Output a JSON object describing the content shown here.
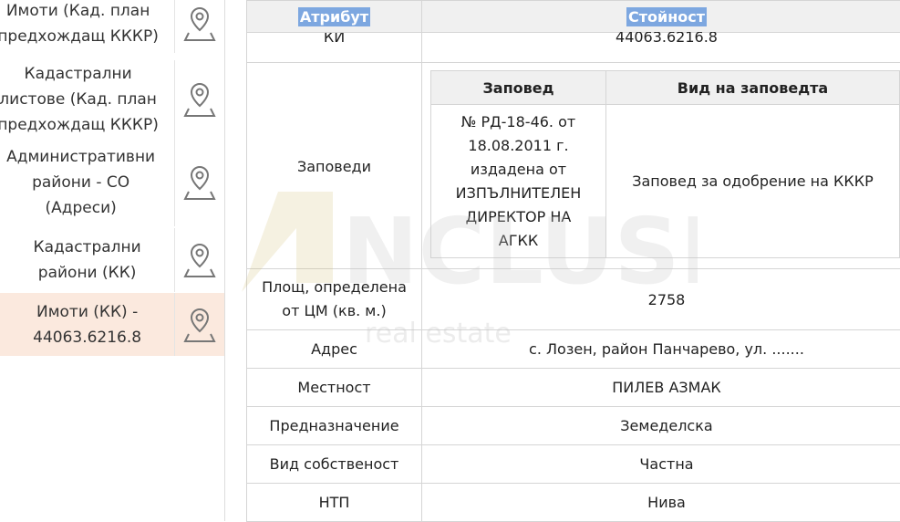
{
  "sidebar": {
    "items": [
      {
        "label": "Имоти (Кад. план\nпредхождащ КККР)",
        "icon": "map-pin-icon"
      },
      {
        "label": "Кадастрални\nлистове (Кад. план\nпредхождащ КККР)",
        "icon": "map-pin-icon"
      },
      {
        "label": "Административни\nрайони - СО\n(Адреси)",
        "icon": "map-pin-icon"
      },
      {
        "label": "Кадастрални\nрайони (КК)",
        "icon": "map-pin-icon"
      },
      {
        "label": "Имоти (КК) -\n44063.6216.8",
        "icon": "map-pin-icon",
        "active": true
      }
    ]
  },
  "table": {
    "col_attr": "Атрибут",
    "col_value": "Стойност",
    "first_row": {
      "attr": "КИ",
      "value": "44063.6216.8"
    },
    "orders": {
      "attr": "Заповеди",
      "col_order": "Заповед",
      "col_type": "Вид на заповедта",
      "order_text": "№ РД-18-46. от\n18.08.2011 г.\nиздадена от\nИЗПЪЛНИТЕЛЕН\nДИРЕКТОР НА\nАГКК",
      "order_type": "Заповед за одобрение на КККР"
    },
    "rows": [
      {
        "attr": "Площ, определена\nот ЦМ (кв. м.)",
        "value": "2758"
      },
      {
        "attr": "Адрес",
        "value": "с. Лозен, район Панчарево, ул. ......."
      },
      {
        "attr": "Местност",
        "value": "ПИЛЕВ АЗМАК"
      },
      {
        "attr": "Предназначение",
        "value": "Земеделска"
      },
      {
        "attr": "Вид собственост",
        "value": "Частна"
      },
      {
        "attr": "НТП",
        "value": "Нива"
      }
    ]
  },
  "watermark": {
    "brand": "NCLUSIVE",
    "sub": "real estate"
  },
  "colors": {
    "highlight": "#7da7e0",
    "active_bg": "#fbe9de"
  }
}
